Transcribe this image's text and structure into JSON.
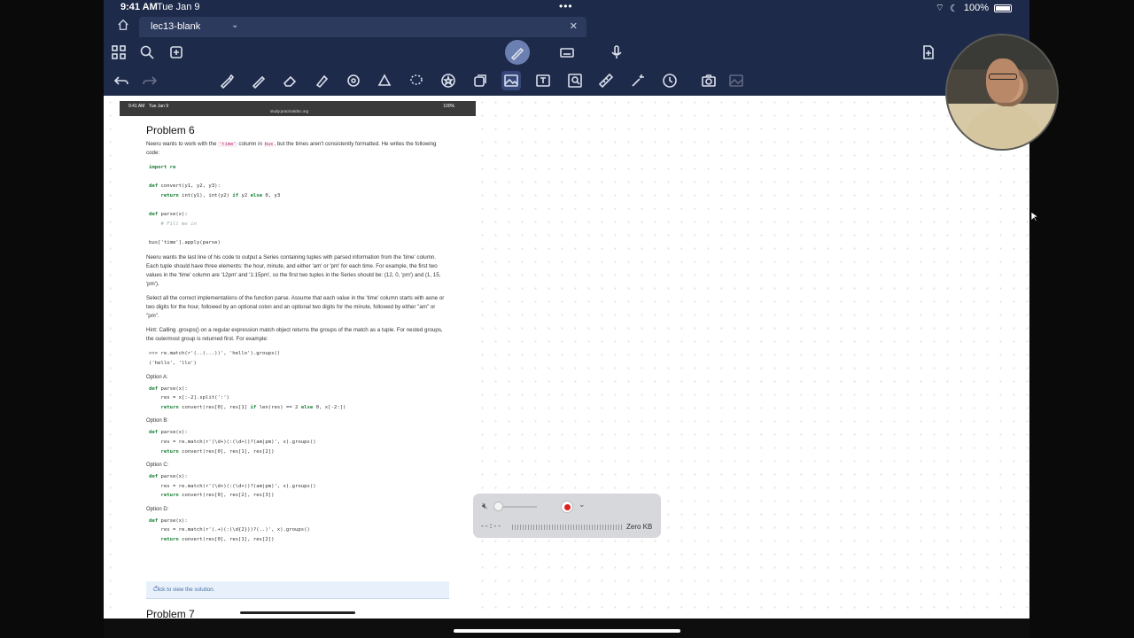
{
  "status": {
    "time": "9:41 AM",
    "date": "Tue Jan 9",
    "battery": "100%"
  },
  "tab": {
    "title": "lec13-blank"
  },
  "doc": {
    "status_time": "9:41 AM",
    "status_date": "Tue Jan 9",
    "status_right": "100%",
    "url": "study.practicaldsc.org",
    "problem_title": "Problem 6",
    "intro_1": "Neeru wants to work with the",
    "intro_code_1": "'time'",
    "intro_2": "column in",
    "intro_code_2": "bus",
    "intro_3": ", but the times aren't consistently formatted. He writes the following code:",
    "code_import": "import re",
    "desc": "Neeru wants the last line of his code to output a Series containing tuples with parsed information from the 'time' column. Each tuple should have three elements: the hour, minute, and either 'am' or 'pm' for each time. For example, the first two values in the 'time' column are '12pm' and '1:15pm', so the first two tuples in the Series should be: (12, 0, 'pm') and (1, 15, 'pm').",
    "select": "Select all the correct implementations of the function parse. Assume that each value in the 'time' column starts with aone or two digits for the hour, followed by an optional colon and an optional two digits for the minute, followed by either \"am\" or \"pm\".",
    "hint": "Hint: Calling .groups() on a regular expression match object returns the groups of the match as a tuple. For nested groups, the outermost group is returned first. For example:",
    "hint_code_1": ">>> re.match(r'(..(...))', 'hello').groups()",
    "hint_code_2": "('hello', 'llo')",
    "option_a": "Option A:",
    "option_b": "Option B:",
    "option_c": "Option C:",
    "option_d": "Option D:",
    "solution": "Click to view the solution.",
    "next_problem": "Problem 7"
  },
  "recorder": {
    "timer": "--:--",
    "size": "Zero KB"
  }
}
